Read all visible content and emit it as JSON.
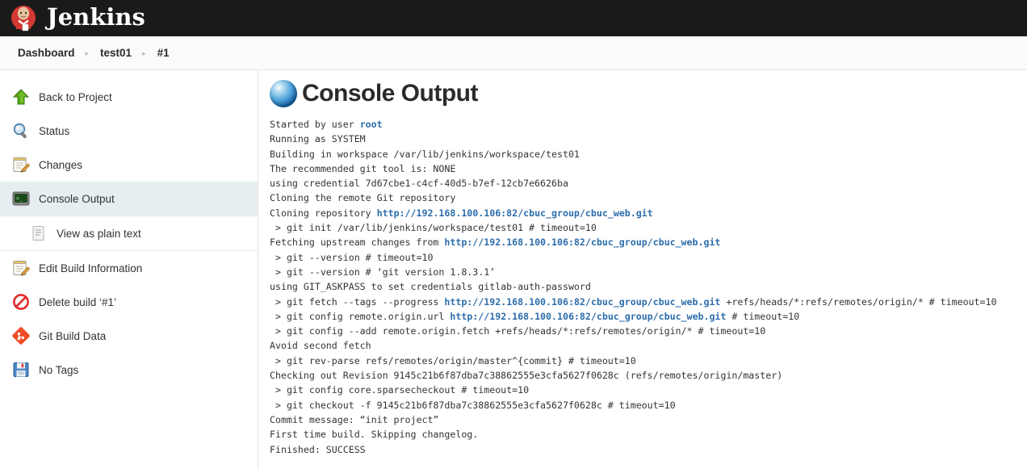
{
  "topbar": {
    "title": "Jenkins",
    "logo_icon": "jenkins-butler-icon"
  },
  "breadcrumb": {
    "separator": "▸",
    "items": [
      {
        "label": "Dashboard"
      },
      {
        "label": "test01"
      },
      {
        "label": "#1"
      }
    ]
  },
  "sidebar": {
    "items": [
      {
        "label": "Back to Project",
        "icon": "green-up-arrow-icon",
        "active": false
      },
      {
        "label": "Status",
        "icon": "magnifier-icon",
        "active": false
      },
      {
        "label": "Changes",
        "icon": "notepad-pencil-icon",
        "active": false
      },
      {
        "label": "Console Output",
        "icon": "terminal-icon",
        "active": true
      },
      {
        "label": "Edit Build Information",
        "icon": "notepad-pencil-icon",
        "active": false
      },
      {
        "label": "Delete build ‘#1’",
        "icon": "no-entry-icon",
        "active": false
      },
      {
        "label": "Git Build Data",
        "icon": "git-diamond-icon",
        "active": false
      },
      {
        "label": "No Tags",
        "icon": "floppy-disk-icon",
        "active": false
      }
    ],
    "sub_item": {
      "label": "View as plain text",
      "icon": "plain-text-document-icon"
    }
  },
  "main": {
    "title": "Console Output",
    "title_icon": "blue-sphere-icon",
    "link_color": "#2c6dab",
    "log_lines": [
      [
        {
          "t": "Started by user "
        },
        {
          "t": "root",
          "link": true
        }
      ],
      [
        {
          "t": "Running as SYSTEM"
        }
      ],
      [
        {
          "t": "Building in workspace /var/lib/jenkins/workspace/test01"
        }
      ],
      [
        {
          "t": "The recommended git tool is: NONE"
        }
      ],
      [
        {
          "t": "using credential 7d67cbe1-c4cf-40d5-b7ef-12cb7e6626ba"
        }
      ],
      [
        {
          "t": "Cloning the remote Git repository"
        }
      ],
      [
        {
          "t": "Cloning repository "
        },
        {
          "t": "http://192.168.100.106:82/cbuc_group/cbuc_web.git",
          "link": true
        }
      ],
      [
        {
          "t": " > git init /var/lib/jenkins/workspace/test01 # timeout=10"
        }
      ],
      [
        {
          "t": "Fetching upstream changes from "
        },
        {
          "t": "http://192.168.100.106:82/cbuc_group/cbuc_web.git",
          "link": true
        }
      ],
      [
        {
          "t": " > git --version # timeout=10"
        }
      ],
      [
        {
          "t": " > git --version # ‘git version 1.8.3.1’"
        }
      ],
      [
        {
          "t": "using GIT_ASKPASS to set credentials gitlab-auth-password"
        }
      ],
      [
        {
          "t": " > git fetch --tags --progress "
        },
        {
          "t": "http://192.168.100.106:82/cbuc_group/cbuc_web.git",
          "link": true
        },
        {
          "t": " +refs/heads/*:refs/remotes/origin/* # timeout=10"
        }
      ],
      [
        {
          "t": " > git config remote.origin.url "
        },
        {
          "t": "http://192.168.100.106:82/cbuc_group/cbuc_web.git",
          "link": true
        },
        {
          "t": " # timeout=10"
        }
      ],
      [
        {
          "t": " > git config --add remote.origin.fetch +refs/heads/*:refs/remotes/origin/* # timeout=10"
        }
      ],
      [
        {
          "t": "Avoid second fetch"
        }
      ],
      [
        {
          "t": " > git rev-parse refs/remotes/origin/master^{commit} # timeout=10"
        }
      ],
      [
        {
          "t": "Checking out Revision 9145c21b6f87dba7c38862555e3cfa5627f0628c (refs/remotes/origin/master)"
        }
      ],
      [
        {
          "t": " > git config core.sparsecheckout # timeout=10"
        }
      ],
      [
        {
          "t": " > git checkout -f 9145c21b6f87dba7c38862555e3cfa5627f0628c # timeout=10"
        }
      ],
      [
        {
          "t": "Commit message: “init project”"
        }
      ],
      [
        {
          "t": "First time build. Skipping changelog."
        }
      ],
      [
        {
          "t": "Finished: SUCCESS"
        }
      ]
    ]
  }
}
